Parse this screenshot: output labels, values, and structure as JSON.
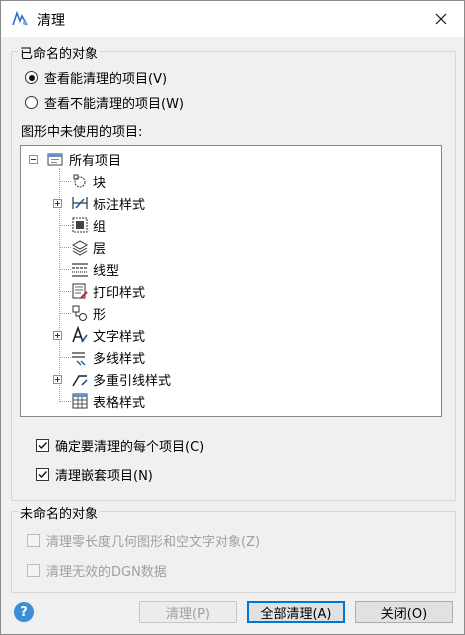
{
  "window": {
    "title": "清理"
  },
  "named_group": {
    "label": "已命名的对象",
    "radio_purgeable": "查看能清理的项目(V)",
    "radio_nonpurgeable": "查看不能清理的项目(W)",
    "tree_caption": "图形中未使用的项目:",
    "tree": {
      "root": "所有项目",
      "items": [
        {
          "label": "块",
          "icon": "block-icon",
          "expandable": false
        },
        {
          "label": "标注样式",
          "icon": "dimension-style-icon",
          "expandable": true
        },
        {
          "label": "组",
          "icon": "group-icon",
          "expandable": false
        },
        {
          "label": "层",
          "icon": "layer-icon",
          "expandable": false
        },
        {
          "label": "线型",
          "icon": "linetype-icon",
          "expandable": false
        },
        {
          "label": "打印样式",
          "icon": "plot-style-icon",
          "expandable": false
        },
        {
          "label": "形",
          "icon": "shape-icon",
          "expandable": false
        },
        {
          "label": "文字样式",
          "icon": "text-style-icon",
          "expandable": true
        },
        {
          "label": "多线样式",
          "icon": "multiline-style-icon",
          "expandable": false
        },
        {
          "label": "多重引线样式",
          "icon": "mleader-style-icon",
          "expandable": true
        },
        {
          "label": "表格样式",
          "icon": "table-style-icon",
          "expandable": false
        }
      ]
    },
    "check_confirm": "确定要清理的每个项目(C)",
    "check_nested": "清理嵌套项目(N)"
  },
  "unnamed_group": {
    "label": "未命名的对象",
    "check_zero_length": "清理零长度几何图形和空文字对象(Z)",
    "check_dgn": "清理无效的DGN数据"
  },
  "buttons": {
    "help": "?",
    "purge": "清理(P)",
    "purge_all": "全部清理(A)",
    "close": "关闭(O)"
  },
  "state": {
    "radio_selected": "purgeable",
    "confirm_checked": true,
    "nested_checked": true,
    "zero_length_checked": false,
    "dgn_checked": false
  },
  "colors": {
    "accent": "#0078d7",
    "help_icon": "#3a8fd8"
  }
}
